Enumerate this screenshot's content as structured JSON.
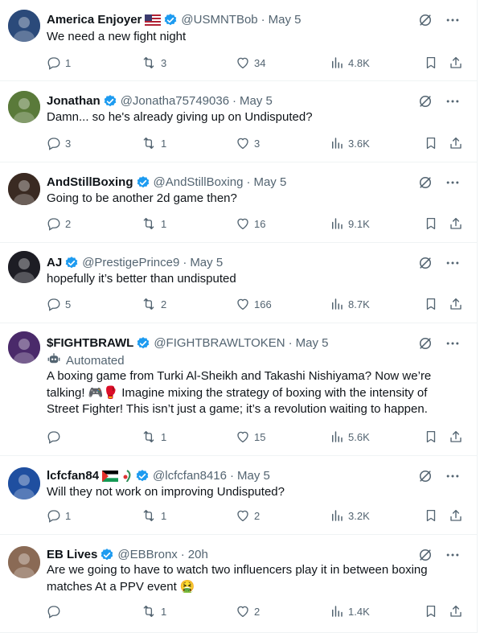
{
  "tweets": [
    {
      "name": "America Enjoyer",
      "flag": "US",
      "handle": "@USMNTBob",
      "date": "May 5",
      "text": "We need a new fight night",
      "automated": "",
      "replies": "1",
      "reposts": "3",
      "likes": "34",
      "views": "4.8K",
      "avatar_color": "#2b4a7a"
    },
    {
      "name": "Jonathan",
      "flag": "",
      "handle": "@Jonatha75749036",
      "date": "May 5",
      "text": "Damn... so he's already giving up on Undisputed?",
      "automated": "",
      "replies": "3",
      "reposts": "1",
      "likes": "3",
      "views": "3.6K",
      "avatar_color": "#5a7a3a"
    },
    {
      "name": "AndStillBoxing",
      "flag": "",
      "handle": "@AndStillBoxing",
      "date": "May 5",
      "text": "Going to be another 2d game then?",
      "automated": "",
      "replies": "2",
      "reposts": "1",
      "likes": "16",
      "views": "9.1K",
      "avatar_color": "#3a2a22"
    },
    {
      "name": "AJ",
      "flag": "",
      "handle": "@PrestigePrince9",
      "date": "May 5",
      "text": "hopefully it’s better than undisputed",
      "automated": "",
      "replies": "5",
      "reposts": "2",
      "likes": "166",
      "views": "8.7K",
      "avatar_color": "#1d1d24"
    },
    {
      "name": "$FIGHTBRAWL",
      "flag": "",
      "handle": "@FIGHTBRAWLTOKEN",
      "date": "May 5",
      "text": "A boxing game from Turki Al-Sheikh and Takashi Nishiyama? Now we’re talking! 🎮🥊 Imagine mixing the strategy of boxing with the intensity of Street Fighter! This isn’t just a game; it’s a revolution waiting to happen.",
      "automated": "Automated",
      "replies": "",
      "reposts": "1",
      "likes": "15",
      "views": "5.6K",
      "avatar_color": "#4a2a6a"
    },
    {
      "name": "lcfcfan84",
      "flag": "PS",
      "handle": "@lcfcfan8416",
      "date": "May 5",
      "text": "Will they not work on improving Undisputed?",
      "automated": "",
      "replies": "1",
      "reposts": "1",
      "likes": "2",
      "views": "3.2K",
      "avatar_color": "#1f4fa0"
    },
    {
      "name": "EB Lives",
      "flag": "",
      "handle": "@EBBronx",
      "date": "20h",
      "text": "Are we going to have to watch two influencers play it in between boxing matches At a PPV event 🤮",
      "automated": "",
      "replies": "",
      "reposts": "1",
      "likes": "2",
      "views": "1.4K",
      "avatar_color": "#8a6a55"
    }
  ],
  "icons": {
    "verified": "verified-badge-icon",
    "grok": "grok-icon",
    "more": "more-dots-icon",
    "reply": "reply-icon",
    "repost": "repost-icon",
    "like": "heart-icon",
    "views": "views-icon",
    "bookmark": "bookmark-icon",
    "share": "share-icon",
    "bot": "bot-icon"
  },
  "colors": {
    "verified": "#1d9bf0",
    "muted": "#536471",
    "text": "#0f1419"
  }
}
